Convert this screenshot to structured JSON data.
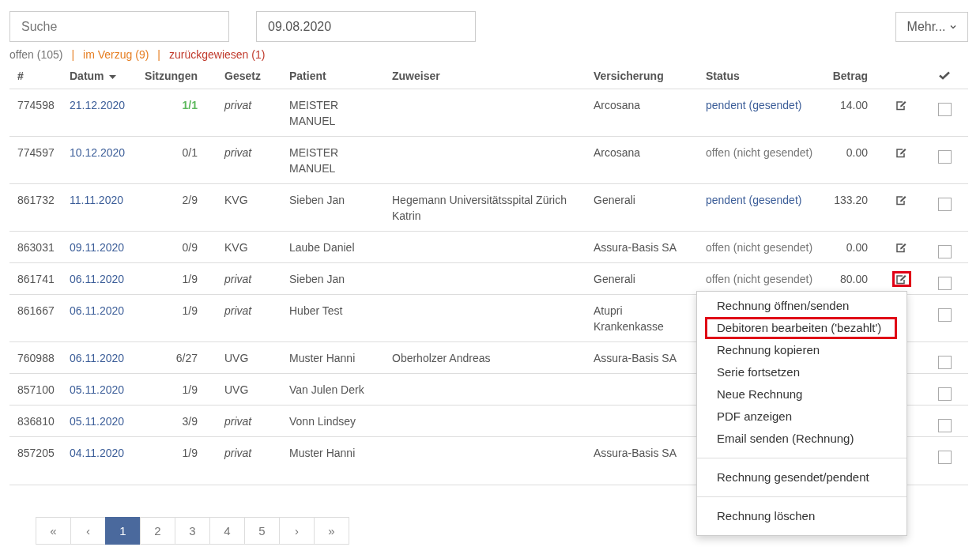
{
  "toolbar": {
    "search": {
      "placeholder": "Suche"
    },
    "date": {
      "value": "09.08.2020"
    },
    "more_button": {
      "label": "Mehr..."
    }
  },
  "filters": [
    {
      "label": "offen (105)",
      "color": "#777777"
    },
    {
      "separator": "|",
      "label": "im Verzug (9)",
      "color": "#e67e22"
    },
    {
      "separator": "|",
      "label": "zurückgewiesen (1)",
      "color": "#c0392b"
    }
  ],
  "table": {
    "columns": [
      {
        "label": "#",
        "sorted": false
      },
      {
        "label": "Datum",
        "sorted": true
      },
      {
        "label": "Sitzungen",
        "sorted": false
      },
      {
        "label": "Gesetz",
        "sorted": false
      },
      {
        "label": "Patient",
        "sorted": false
      },
      {
        "label": "Zuweiser",
        "sorted": false
      },
      {
        "label": "Versicherung",
        "sorted": false
      },
      {
        "label": "Status",
        "sorted": false
      },
      {
        "label": "Betrag",
        "sorted": false
      }
    ],
    "rows": [
      {
        "number": "774598",
        "date": "21.12.2020",
        "sessions": "1/1",
        "sessions_complete": true,
        "law": "privat",
        "law_private": true,
        "patient": "MEISTER MANUEL",
        "referrer": "",
        "insurance": "Arcosana",
        "status": "pendent (gesendet)",
        "sent": true,
        "amount": "14.00",
        "highlighted": false,
        "checked": false
      },
      {
        "number": "774597",
        "date": "10.12.2020",
        "sessions": "0/1",
        "sessions_complete": false,
        "law": "privat",
        "law_private": true,
        "patient": "MEISTER MANUEL",
        "referrer": "",
        "insurance": "Arcosana",
        "status": "offen (nicht gesendet)",
        "sent": false,
        "amount": "0.00",
        "highlighted": false,
        "checked": false
      },
      {
        "number": "861732",
        "date": "11.11.2020",
        "sessions": "2/9",
        "sessions_complete": false,
        "law": "KVG",
        "law_private": false,
        "patient": "Sieben Jan",
        "referrer": "Hegemann Universitätsspital Zürich Katrin",
        "insurance": "Generali",
        "status": "pendent (gesendet)",
        "sent": true,
        "amount": "133.20",
        "highlighted": false,
        "checked": false
      },
      {
        "number": "863031",
        "date": "09.11.2020",
        "sessions": "0/9",
        "sessions_complete": false,
        "law": "KVG",
        "law_private": false,
        "patient": "Laube Daniel",
        "referrer": "",
        "insurance": "Assura-Basis SA",
        "status": "offen (nicht gesendet)",
        "sent": false,
        "amount": "0.00",
        "highlighted": false,
        "checked": false
      },
      {
        "number": "861741",
        "date": "06.11.2020",
        "sessions": "1/9",
        "sessions_complete": false,
        "law": "privat",
        "law_private": true,
        "patient": "Sieben Jan",
        "referrer": "",
        "insurance": "Generali",
        "status": "offen (nicht gesendet)",
        "sent": false,
        "amount": "80.00",
        "highlighted": true,
        "checked": false
      },
      {
        "number": "861667",
        "date": "06.11.2020",
        "sessions": "1/9",
        "sessions_complete": false,
        "law": "privat",
        "law_private": true,
        "patient": "Huber Test",
        "referrer": "",
        "insurance": "Atupri Krankenkasse",
        "highlighted": false,
        "checked": false
      },
      {
        "number": "760988",
        "date": "06.11.2020",
        "sessions": "6/27",
        "sessions_complete": false,
        "law": "UVG",
        "law_private": false,
        "patient": "Muster Hanni",
        "referrer": "Oberholzer Andreas",
        "insurance": "Assura-Basis SA",
        "highlighted": false,
        "checked": false
      },
      {
        "number": "857100",
        "date": "05.11.2020",
        "sessions": "1/9",
        "sessions_complete": false,
        "law": "UVG",
        "law_private": false,
        "patient": "Van Julen Derk",
        "referrer": "",
        "insurance": "",
        "highlighted": false,
        "checked": false
      },
      {
        "number": "836810",
        "date": "05.11.2020",
        "sessions": "3/9",
        "sessions_complete": false,
        "law": "privat",
        "law_private": true,
        "patient": "Vonn Lindsey",
        "referrer": "",
        "insurance": "",
        "highlighted": false,
        "checked": false
      },
      {
        "number": "857205",
        "date": "04.11.2020",
        "sessions": "1/9",
        "sessions_complete": false,
        "law": "privat",
        "law_private": true,
        "patient": "Muster Hanni",
        "referrer": "",
        "insurance": "Assura-Basis SA",
        "highlighted": false,
        "checked": false
      }
    ]
  },
  "context_menu": {
    "items": [
      {
        "kind": "item",
        "label": "Rechnung öffnen/senden",
        "highlighted": false
      },
      {
        "kind": "item",
        "label": "Debitoren bearbeiten ('bezahlt')",
        "highlighted": true
      },
      {
        "kind": "item",
        "label": "Rechnung kopieren",
        "highlighted": false
      },
      {
        "kind": "item",
        "label": "Serie fortsetzen",
        "highlighted": false
      },
      {
        "kind": "item",
        "label": "Neue Rechnung",
        "highlighted": false
      },
      {
        "kind": "item",
        "label": "PDF anzeigen",
        "highlighted": false
      },
      {
        "kind": "item",
        "label": "Email senden (Rechnung)",
        "highlighted": false
      },
      {
        "kind": "divider"
      },
      {
        "kind": "item",
        "label": "Rechnung gesendet/pendent",
        "highlighted": false
      },
      {
        "kind": "divider"
      },
      {
        "kind": "item",
        "label": "Rechnung löschen",
        "highlighted": false
      }
    ]
  },
  "pagination": [
    {
      "label": "«",
      "selected": false
    },
    {
      "label": "‹",
      "selected": false
    },
    {
      "label": "1",
      "selected": true
    },
    {
      "label": "2",
      "selected": false
    },
    {
      "label": "3",
      "selected": false
    },
    {
      "label": "4",
      "selected": false
    },
    {
      "label": "5",
      "selected": false
    },
    {
      "label": "›",
      "selected": false
    },
    {
      "label": "»",
      "selected": false
    }
  ]
}
